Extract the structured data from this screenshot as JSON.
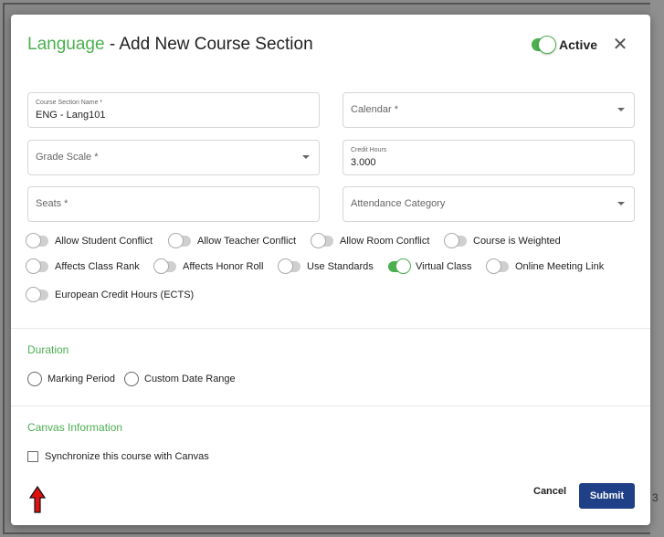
{
  "modal": {
    "title_accent": "Language",
    "title_rest": " - Add New Course Section",
    "active_label": "Active",
    "active_on": true,
    "close_glyph": "✕"
  },
  "fields": {
    "course_section_name": {
      "label": "Course Section Name *",
      "value": "ENG - Lang101"
    },
    "calendar": {
      "placeholder": "Calendar *"
    },
    "grade_scale": {
      "placeholder": "Grade Scale *"
    },
    "credit_hours": {
      "label": "Credit Hours",
      "value": "3.000"
    },
    "seats": {
      "placeholder": "Seats *"
    },
    "attendance_category": {
      "placeholder": "Attendance Category"
    }
  },
  "toggles": [
    {
      "label": "Allow Student Conflict",
      "on": false
    },
    {
      "label": "Allow Teacher Conflict",
      "on": false
    },
    {
      "label": "Allow Room Conflict",
      "on": false
    },
    {
      "label": "Course is Weighted",
      "on": false
    },
    {
      "label": "Affects Class Rank",
      "on": false
    },
    {
      "label": "Affects Honor Roll",
      "on": false
    },
    {
      "label": "Use Standards",
      "on": false
    },
    {
      "label": "Virtual Class",
      "on": true
    },
    {
      "label": "Online Meeting Link",
      "on": false
    },
    {
      "label": "European Credit Hours (ECTS)",
      "on": false
    }
  ],
  "duration": {
    "title": "Duration",
    "options": [
      "Marking Period",
      "Custom Date Range"
    ]
  },
  "canvas": {
    "title": "Canvas Information",
    "sync_label": "Synchronize this course with Canvas",
    "sync_checked": false
  },
  "buttons": {
    "cancel": "Cancel",
    "submit": "Submit"
  },
  "background": {
    "right_edge_digit": "3"
  },
  "colors": {
    "accent_green": "#4caf50",
    "submit_blue": "#1f3f86",
    "arrow_red": "#e01010"
  }
}
